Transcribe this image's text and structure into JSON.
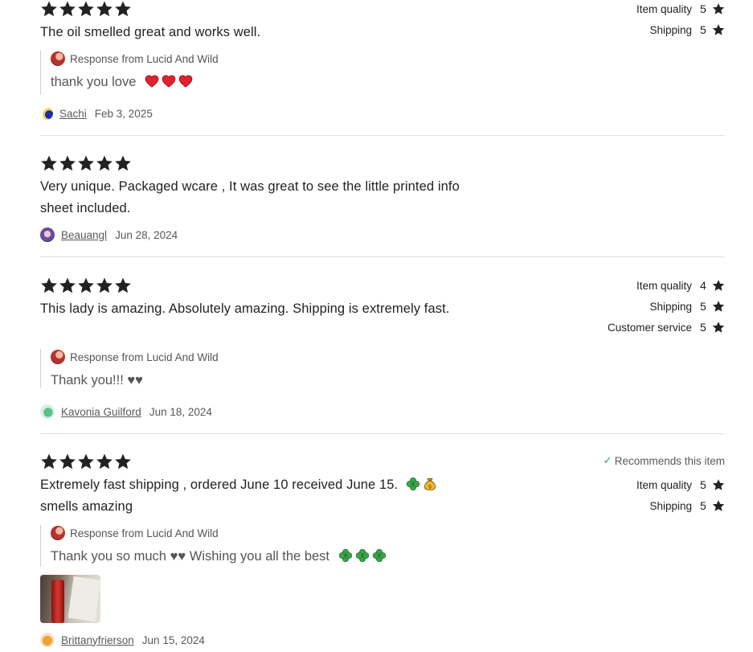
{
  "reviews": [
    {
      "text": "The oil smelled great and works well.",
      "response": {
        "from": "Response from Lucid And Wild",
        "text": "thank you love",
        "emoji": [
          "heart",
          "heart",
          "heart"
        ]
      },
      "reviewer": "Sachi",
      "date": "Feb 3, 2025",
      "stars": 5,
      "ratings": [
        {
          "label": "Item quality",
          "value": "5"
        },
        {
          "label": "Shipping",
          "value": "5"
        }
      ]
    },
    {
      "text": "Very unique. Packaged wcare , It was great to see the little printed info sheet included.",
      "reviewer": "Beauangl",
      "date": "Jun 28, 2024",
      "stars": 5
    },
    {
      "text": "This lady is amazing. Absolutely amazing. Shipping is extremely fast.",
      "response": {
        "from": "Response from Lucid And Wild",
        "text": "Thank you!!! ♥♥"
      },
      "reviewer": "Kavonia Guilford",
      "date": "Jun 18, 2024",
      "stars": 5,
      "ratings": [
        {
          "label": "Item quality",
          "value": "4"
        },
        {
          "label": "Shipping",
          "value": "5"
        },
        {
          "label": "Customer service",
          "value": "5"
        }
      ]
    },
    {
      "text": "Extremely fast shipping , ordered June 10 received June 15.",
      "text_line2": "smells amazing",
      "recommends": "Recommends this item",
      "response": {
        "from": "Response from Lucid And Wild",
        "text": "Thank you so much ♥♥ Wishing you all the best"
      },
      "reviewer": "Brittanyfrierson",
      "date": "Jun 15, 2024",
      "stars": 5,
      "ratings": [
        {
          "label": "Item quality",
          "value": "5"
        },
        {
          "label": "Shipping",
          "value": "5"
        }
      ]
    }
  ],
  "icons": {
    "star": "star-icon",
    "heart": "heart-icon",
    "clover": "clover-icon",
    "moneybag": "money-bag-icon",
    "check": "check-icon"
  },
  "colors": {
    "text": "#222222",
    "muted": "#595959",
    "divider": "#e1e1e1",
    "heart": "#e0242e",
    "clover": "#3aa34a",
    "check": "#3a9b5d"
  }
}
